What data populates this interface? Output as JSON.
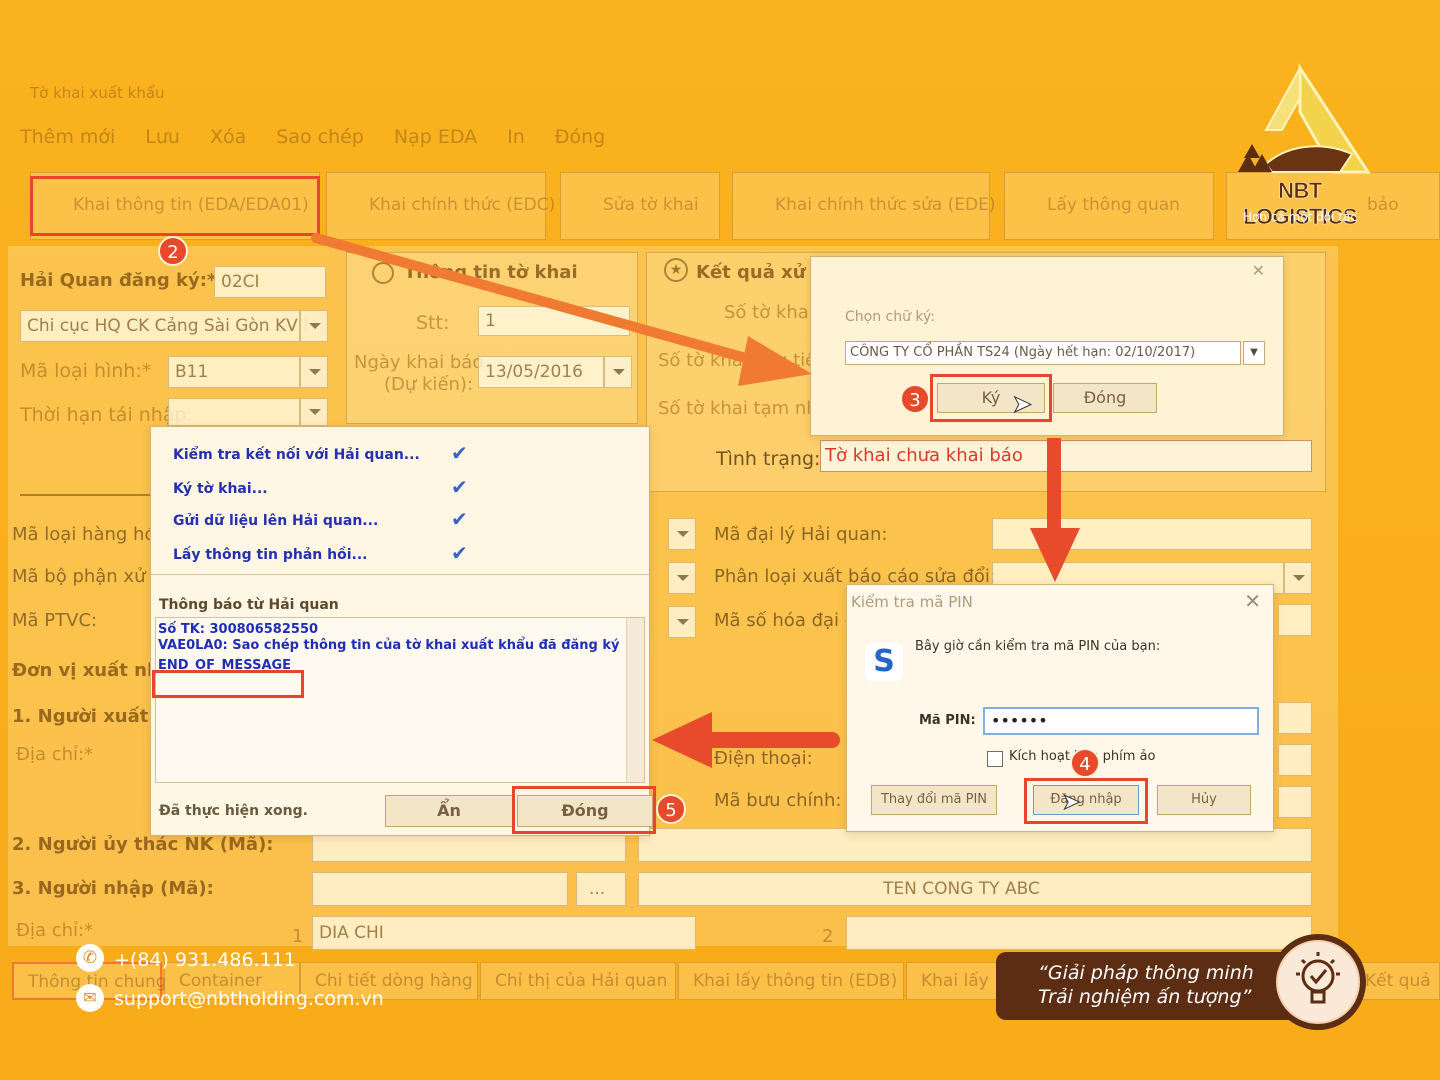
{
  "brand": {
    "name": "NBT LOGISTICS",
    "tagline": "Hơn cả một đối tác",
    "colors": {
      "background": "#f9ad1c",
      "accent": "#e8452c",
      "brown": "#5c2d12"
    }
  },
  "toolbar": {
    "items": [
      "Thêm mới",
      "Lưu",
      "Xóa",
      "Sao chép",
      "Nạp EDA",
      "In",
      "Đóng"
    ]
  },
  "tabs": [
    "Khai thông tin (EDA/EDA01)",
    "Khai chính thức (EDC)",
    "Sửa tờ khai",
    "Khai chính thức sửa (EDE)",
    "Lấy thông quan",
    "bảo"
  ],
  "form": {
    "hq_label": "Hải Quan đăng ký:*",
    "hq_code": "02CI",
    "hq_branch": "Chi cục HQ CK Cảng Sài Gòn KV I",
    "ma_loai_hinh_label": "Mã loại hình:*",
    "ma_loai_hinh_value": "B11",
    "thoi_han_label": "Thời hạn tái nhập:",
    "group_title": "Thông tin tờ khai",
    "stt_label": "Stt:",
    "stt_value": "1",
    "ngay_khai_label_1": "Ngày khai báo",
    "ngay_khai_label_2": "(Dự kiến):",
    "ngay_khai_value": "13/05/2016",
    "ket_qua_title": "Kết quả xử lý",
    "so_to_khai_label": "Số tờ khai:",
    "so_to_khai_dau_label": "Số tờ khai đầu tiên",
    "so_to_khai_tam_label": "Số tờ khai tạm nhập",
    "tinh_trang_label": "Tình trạng:",
    "tinh_trang_value": "Tờ khai chưa khai báo",
    "ma_loai_hang_hoa": "Mã loại hàng hóa",
    "ma_bo_phan": "Mã bộ phận xử lý",
    "ma_ptvc": "Mã PTVC:",
    "don_vi_xuat": "Đơn vị xuất nhập",
    "nguoi_xuat": "1. Người xuất",
    "dia_chi": "Địa chỉ:*",
    "ma_dai_ly": "Mã đại lý Hải quan:",
    "phan_loai": "Phân loại xuất báo cáo sửa đổi:",
    "ma_so_hoa": "Mã số hóa đại diện",
    "dien_thoai": "Điện thoại:",
    "ma_buu_chinh": "Mã bưu chính:",
    "nguoi_uy_thac": "2. Người ủy thác NK (Mã):",
    "nguoi_nhap": "3. Người nhập (Mã):",
    "ten_cong_ty": "TEN CONG TY ABC",
    "dia_chi_2": "Địa chỉ:*",
    "dia_chi_value": "DIA CHI",
    "row_num_1": "1",
    "row_num_2": "2",
    "ellipsis": "..."
  },
  "sign_dialog": {
    "title": "Chọn chữ ký:",
    "certificate": "CÔNG TY CỔ PHẦN TS24 (Ngày hết hạn: 02/10/2017)",
    "sign_button": "Ký",
    "close_button": "Đóng"
  },
  "progress_dialog": {
    "steps": [
      "Kiểm tra kết nối với Hải quan...",
      "Ký tờ khai...",
      "Gửi dữ liệu lên Hải quan...",
      "Lấy thông tin phản hồi..."
    ],
    "message_label": "Thông báo từ Hải quan",
    "message_line_1": "Số TK: 300806582550",
    "message_line_2": "VAE0LA0: Sao chép thông tin của tờ khai xuất khẩu đã đăng ký",
    "message_end": "END_OF_MESSAGE",
    "status": "Đã thực hiện xong.",
    "hide_button": "Ẩn",
    "close_button": "Đóng"
  },
  "pin_dialog": {
    "title": "Kiểm tra mã PIN",
    "prompt": "Bây giờ cần kiểm tra mã PIN của bạn:",
    "pin_label": "Mã PIN:",
    "pin_value": "••••••",
    "virtual_kb_label": "Kích hoạt bàn phím ảo",
    "change_pin_button": "Thay đổi mã PIN",
    "login_button": "Đăng nhập",
    "cancel_button": "Hủy",
    "logo_letter": "S"
  },
  "step_numbers": [
    "2",
    "3",
    "4",
    "5"
  ],
  "bottom_tabs": [
    "Thông tin chung",
    "Container",
    "Chi tiết dòng hàng",
    "Chỉ thị của Hải quan",
    "Khai lấy thông tin (EDB)",
    "Khai lấy",
    "Kết quả"
  ],
  "contact": {
    "phone": "+(84) 931.486.111",
    "email": "support@nbtholding.com.vn"
  },
  "slogan": {
    "line1": "“Giải pháp thông minh",
    "line2": "Trải nghiệm ấn tượng”"
  }
}
